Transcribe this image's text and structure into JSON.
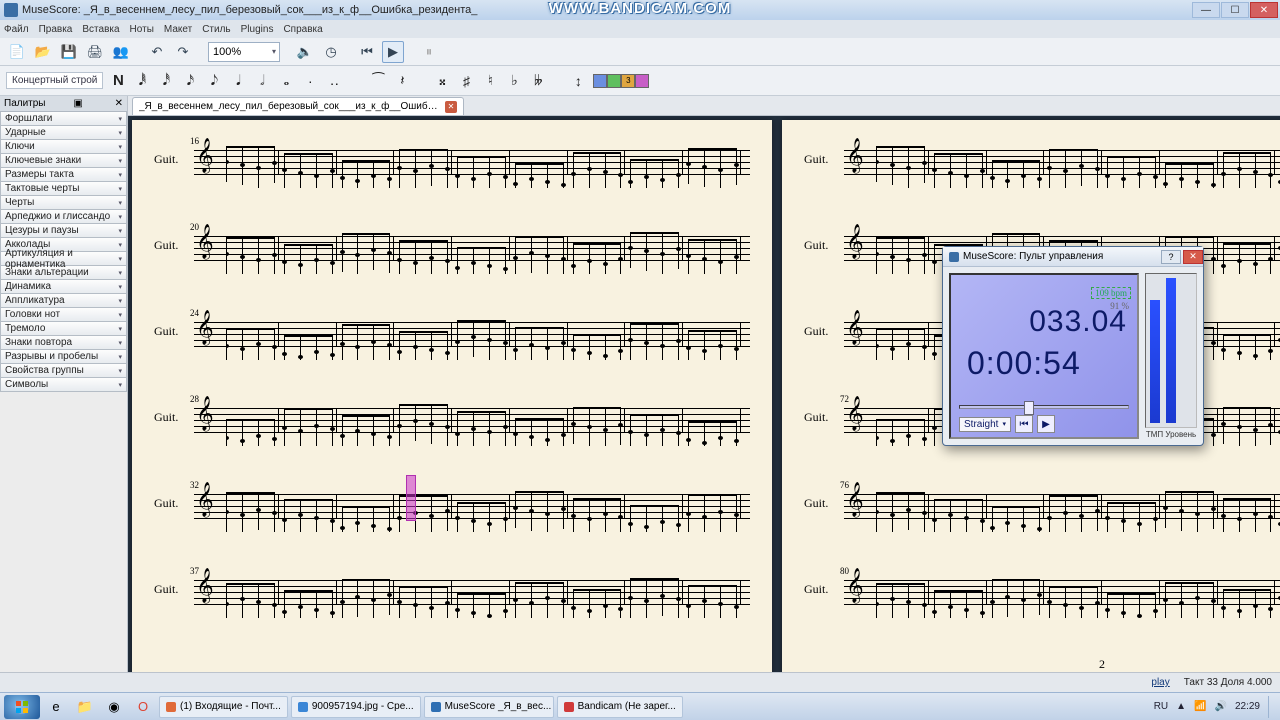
{
  "window": {
    "title": "MuseScore:  _Я_в_весеннем_лесу_пил_березовый_сок___из_к_ф__Ошибка_резидента_",
    "min": "—",
    "max": "☐",
    "close": "✕"
  },
  "watermark": "WWW.BANDICAM.COM",
  "menu": [
    "Файл",
    "Правка",
    "Вставка",
    "Ноты",
    "Макет",
    "Стиль",
    "Plugins",
    "Справка"
  ],
  "toolbar": {
    "zoom": "100%"
  },
  "notebar": {
    "concert_pitch": "Концертный строй",
    "note_entry": "N",
    "voice3": "3"
  },
  "palettes": {
    "header": "Палитры",
    "items": [
      "Форшлаги",
      "Ударные",
      "Ключи",
      "Ключевые знаки",
      "Размеры такта",
      "Тактовые черты",
      "Черты",
      "Арпеджио и глиссандо",
      "Цезуры и паузы",
      "Акколады",
      "Артикуляция и орнаментика",
      "Знаки альтерации",
      "Динамика",
      "Аппликатура",
      "Головки нот",
      "Тремоло",
      "Знаки повтора",
      "Разрывы и пробелы",
      "Свойства группы",
      "Символы"
    ]
  },
  "doctab": {
    "label": "_Я_в_весеннем_лесу_пил_березовый_сок___из_к_ф__Ошибка_резидента_*"
  },
  "score": {
    "instrument": "Guit.",
    "page_left_num": "",
    "page_right_num": "2",
    "measures_left": [
      "16",
      "20",
      "24",
      "28",
      "32",
      "37"
    ],
    "measures_right": [
      "",
      "",
      "",
      "72",
      "76",
      "80"
    ]
  },
  "play_panel": {
    "title": "MuseScore: Пульт управления",
    "bars": "033.04",
    "time": "0:00:54",
    "bpm": "109 bpm",
    "pct": "91 %",
    "swing": "Straight",
    "meter_label": "ТМП  Уровень"
  },
  "status": {
    "link": "play",
    "info": "Такт  33 Доля  4.000"
  },
  "taskbar": {
    "tabs": [
      {
        "label": "(1) Входящие - Почт...",
        "color": "#e06a39"
      },
      {
        "label": "900957194.jpg - Сре...",
        "color": "#3a86d6"
      },
      {
        "label": "MuseScore  _Я_в_вес...",
        "color": "#2f6fb3"
      },
      {
        "label": "Bandicam (Не зарег...",
        "color": "#d03a3a"
      }
    ],
    "lang": "RU",
    "clock": "22:29"
  }
}
